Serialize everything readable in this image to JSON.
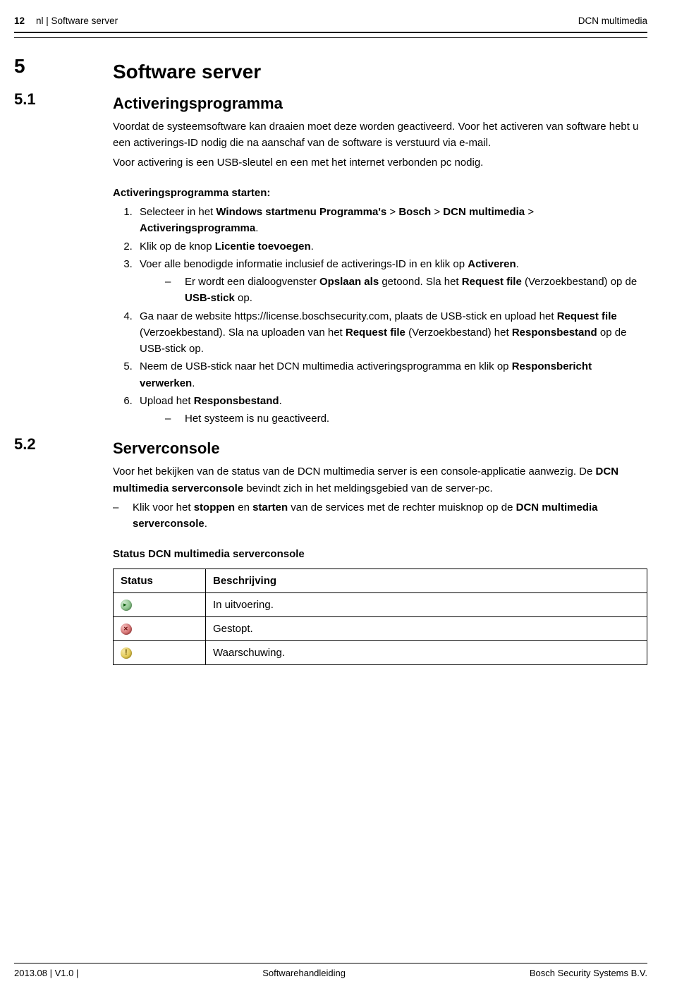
{
  "header": {
    "page_number": "12",
    "breadcrumb": "nl | Software server",
    "product": "DCN multimedia"
  },
  "s5": {
    "num": "5",
    "title": "Software server"
  },
  "s51": {
    "num": "5.1",
    "title": "Activeringsprogramma",
    "intro1": "Voordat de systeemsoftware kan draaien moet deze worden geactiveerd. Voor het activeren van software hebt u een activerings-ID nodig die na aanschaf van de software is verstuurd via e-mail.",
    "intro2": "Voor activering is een USB-sleutel en een met het internet verbonden pc nodig.",
    "start_heading": "Activeringsprogramma starten:",
    "step1_a": "Selecteer in het ",
    "step1_b": "Windows startmenu Programma's",
    "step1_c": " > ",
    "step1_d": "Bosch",
    "step1_e": " > ",
    "step1_f": "DCN multimedia",
    "step1_g": " > ",
    "step1_h": "Activeringsprogramma",
    "step1_i": ".",
    "step2_a": "Klik op de knop ",
    "step2_b": "Licentie toevoegen",
    "step2_c": ".",
    "step3_a": "Voer alle benodigde informatie inclusief de activerings-ID in en klik op ",
    "step3_b": "Activeren",
    "step3_c": ".",
    "step3_sub_a": "Er wordt een dialoogvenster ",
    "step3_sub_b": "Opslaan als",
    "step3_sub_c": " getoond. Sla het ",
    "step3_sub_d": "Request file",
    "step3_sub_e": " (Verzoekbestand) op de ",
    "step3_sub_f": "USB-stick",
    "step3_sub_g": " op.",
    "step4_a": "Ga naar de website https://license.boschsecurity.com, plaats de USB-stick en upload het ",
    "step4_b": "Request file",
    "step4_c": " (Verzoekbestand). Sla na uploaden van het ",
    "step4_d": "Request file",
    "step4_e": " (Verzoekbestand) het ",
    "step4_f": "Responsbestand",
    "step4_g": " op de USB-stick op.",
    "step5_a": "Neem de USB-stick naar het DCN multimedia activeringsprogramma en klik op ",
    "step5_b": "Responsbericht verwerken",
    "step5_c": ".",
    "step6_a": "Upload het ",
    "step6_b": "Responsbestand",
    "step6_c": ".",
    "step6_sub": "Het systeem is nu geactiveerd."
  },
  "s52": {
    "num": "5.2",
    "title": "Serverconsole",
    "p1_a": "Voor het bekijken van de status van de DCN multimedia server is een console-applicatie aanwezig. De ",
    "p1_b": "DCN multimedia serverconsole",
    "p1_c": " bevindt zich in het meldingsgebied van de server-pc.",
    "bullet_a": "Klik voor het ",
    "bullet_b": "stoppen",
    "bullet_c": " en ",
    "bullet_d": "starten",
    "bullet_e": " van de services met de rechter muisknop op de ",
    "bullet_f": "DCN multimedia serverconsole",
    "bullet_g": ".",
    "table_heading": "Status DCN multimedia serverconsole",
    "th_status": "Status",
    "th_desc": "Beschrijving",
    "row1": "In uitvoering.",
    "row2": "Gestopt.",
    "row3": "Waarschuwing."
  },
  "footer": {
    "left": "2013.08 | V1.0 |",
    "center": "Softwarehandleiding",
    "right": "Bosch Security Systems B.V."
  }
}
